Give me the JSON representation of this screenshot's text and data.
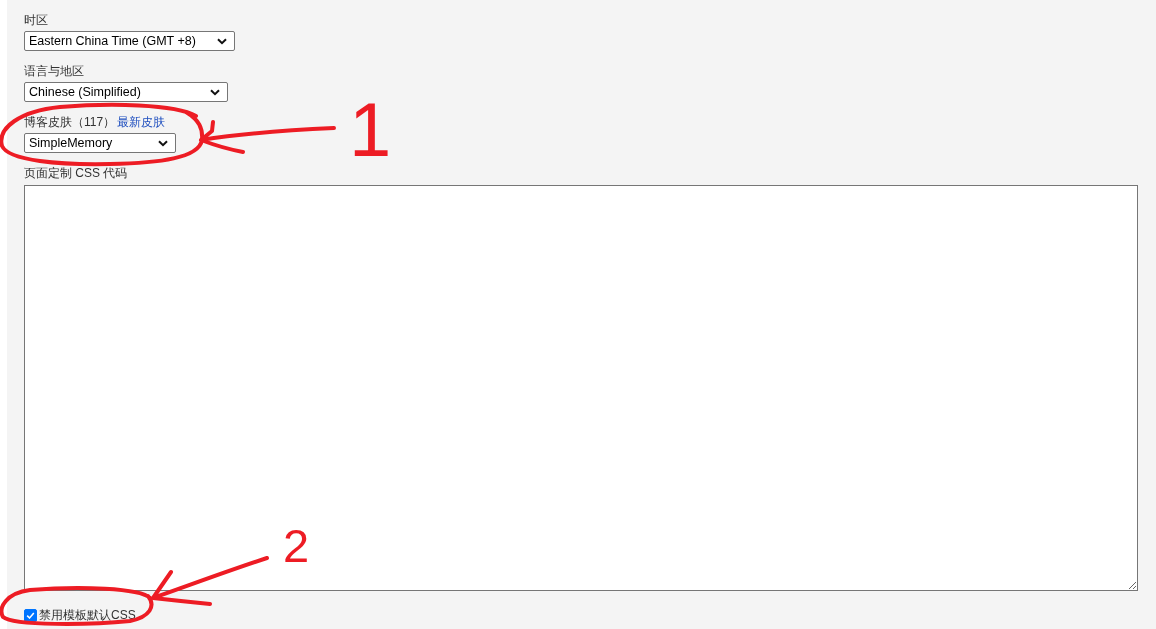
{
  "fields": [
    {
      "kind": "select",
      "label": "时区",
      "value": "Eastern China Time (GMT +8)"
    },
    {
      "kind": "select",
      "label": "语言与地区",
      "value": "Chinese (Simplified)"
    },
    {
      "kind": "select",
      "label": "博客皮肤（117）",
      "link": "最新皮肤",
      "value": "SimpleMemory"
    },
    {
      "kind": "textarea",
      "label": "页面定制 CSS 代码"
    },
    {
      "kind": "checkbox",
      "label": "禁用模板默认CSS",
      "checked": true
    }
  ],
  "annotations": [
    {
      "number": "1"
    },
    {
      "number": "2"
    }
  ]
}
